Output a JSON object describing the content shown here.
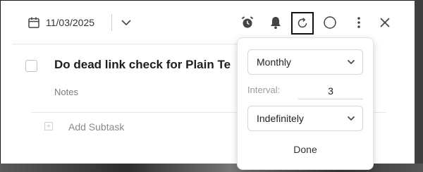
{
  "header": {
    "date": "11/03/2025",
    "icons": [
      "calendar-icon",
      "chevron-down-icon",
      "alarm-icon",
      "bell-icon",
      "repeat-icon",
      "circle-icon",
      "more-vertical-icon",
      "close-icon"
    ]
  },
  "task": {
    "title": "Do dead link check for Plain Te",
    "notes_placeholder": "Notes",
    "add_subtask_label": "Add Subtask"
  },
  "recurrence": {
    "frequency": "Monthly",
    "interval_label": "Interval:",
    "interval_value": "3",
    "end": "Indefinitely",
    "done_label": "Done"
  },
  "colors": {
    "accent": "#111111",
    "muted_text": "#8a8a8a"
  }
}
